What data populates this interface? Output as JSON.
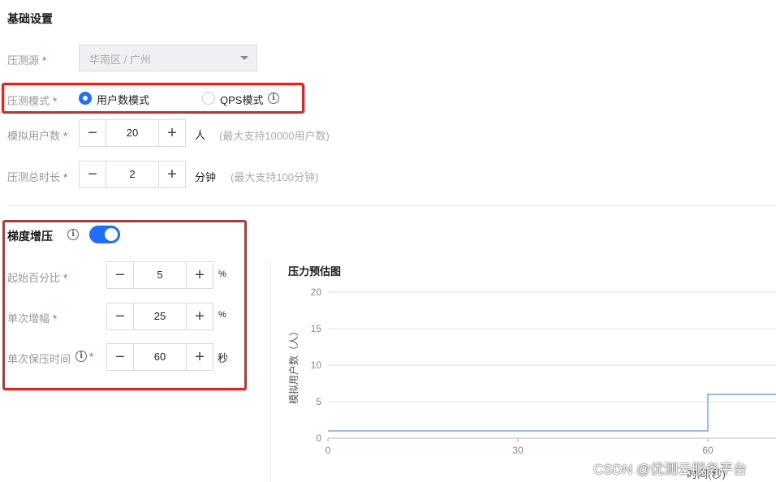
{
  "basic": {
    "title": "基础设置",
    "source": {
      "label": "压测源",
      "value": "华南区 / 广州"
    },
    "mode": {
      "label": "压测模式",
      "options": [
        "用户数模式",
        "QPS模式"
      ],
      "selected": "用户数模式"
    },
    "users": {
      "label": "模拟用户数",
      "value": "20",
      "unit": "人",
      "hint": "(最大支持10000用户数)"
    },
    "duration": {
      "label": "压测总时长",
      "value": "2",
      "unit": "分钟",
      "hint": "(最大支持100分钟)"
    }
  },
  "gradient": {
    "title": "梯度增压",
    "enabled": true,
    "start_percent": {
      "label": "起始百分比",
      "value": "5",
      "unit": "%"
    },
    "step_increase": {
      "label": "单次增幅",
      "value": "25",
      "unit": "%"
    },
    "hold_time": {
      "label": "单次保压时间",
      "value": "60",
      "unit": "秒"
    }
  },
  "required_mark": "*",
  "stepper_symbols": {
    "minus": "−",
    "plus": "+"
  },
  "info_symbol": "i",
  "colors": {
    "accent": "#1e6fff",
    "highlight": "#e8231f",
    "line": "#5b8ff9"
  },
  "chart_data": {
    "type": "line",
    "title": "压力预估图",
    "ylabel": "模拟用户数（人）",
    "xlabel": "时间(秒)",
    "ylim": [
      0,
      20
    ],
    "yticks": [
      0,
      5,
      10,
      15,
      20
    ],
    "xticks": [
      0,
      30,
      60
    ],
    "grid": true,
    "series": [
      {
        "x": [
          0,
          60,
          60,
          72
        ],
        "y": [
          1,
          1,
          6,
          6
        ]
      }
    ]
  },
  "watermark": "CSDN @优测云服务平台"
}
